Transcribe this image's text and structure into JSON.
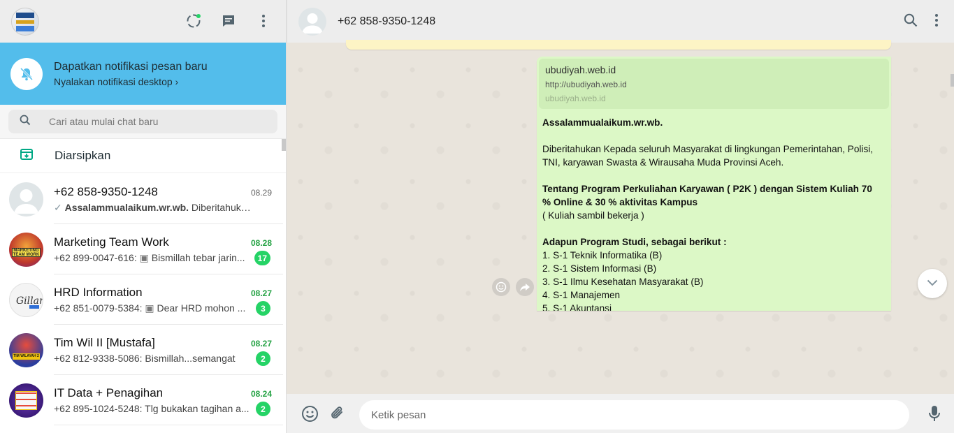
{
  "sidebar": {
    "notification": {
      "title": "Dapatkan notifikasi pesan baru",
      "link": "Nyalakan notifikasi desktop ›"
    },
    "search": {
      "placeholder": "Cari atau mulai chat baru"
    },
    "archived_label": "Diarsipkan",
    "chats": [
      {
        "name": "+62 858-9350-1248",
        "time": "08.29",
        "sender": "",
        "preview_bold": "Assalammualaikum.wr.wb.",
        "preview": " Diberitahukan K...",
        "unread": "",
        "avatar": "default"
      },
      {
        "name": "Marketing Team Work",
        "time": "08.28",
        "sender": "+62 899-0047-616: ",
        "preview_bold": "",
        "preview": "Bismillah tebar jarin...",
        "unread": "17",
        "avatar": "marketing"
      },
      {
        "name": "HRD Information",
        "time": "08.27",
        "sender": "+62 851-0079-5384: ",
        "preview_bold": "",
        "preview": "Dear HRD mohon ...",
        "unread": "3",
        "avatar": "hrd"
      },
      {
        "name": "Tim Wil II [Mustafa]",
        "time": "08.27",
        "sender": "+62 812-9338-5086: ",
        "preview_bold": "",
        "preview": "Bismillah...semangat",
        "unread": "2",
        "avatar": "timwil"
      },
      {
        "name": "IT Data + Penagihan",
        "time": "08.24",
        "sender": "+62 895-1024-5248: ",
        "preview_bold": "",
        "preview": "Tlg bukakan tagihan a...",
        "unread": "2",
        "avatar": "itdata"
      }
    ]
  },
  "conversation": {
    "contact_name": "+62 858-9350-1248",
    "link_preview": {
      "title": "ubudiyah.web.id",
      "url": "http://ubudiyah.web.id",
      "domain": "ubudiyah.web.id"
    },
    "message_lines": [
      {
        "text": "Assalammualaikum.wr.wb.",
        "bold": true
      },
      {
        "text": "",
        "bold": false
      },
      {
        "text": "Diberitahukan Kepada seluruh Masyarakat di lingkungan Pemerintahan, Polisi,",
        "bold": false
      },
      {
        "text": "TNI, karyawan Swasta & Wirausaha Muda Provinsi Aceh.",
        "bold": false
      },
      {
        "text": "",
        "bold": false
      },
      {
        "text": "Tentang Program Perkuliahan Karyawan ( P2K ) dengan  Sistem Kuliah 70",
        "bold": true
      },
      {
        "text": "%  Online & 30 % aktivitas Kampus",
        "bold": true
      },
      {
        "text": "( Kuliah sambil bekerja )",
        "bold": false
      },
      {
        "text": "",
        "bold": false
      },
      {
        "text": "Adapun Program Studi, sebagai berikut :",
        "bold": true
      },
      {
        "text": "1. S-1 Teknik Informatika (B)",
        "bold": false
      },
      {
        "text": "2. S-1 Sistem Informasi (B)",
        "bold": false
      },
      {
        "text": "3. S-1 Ilmu Kesehatan Masyarakat (B)",
        "bold": false
      },
      {
        "text": "4. S-1 Manajemen",
        "bold": false
      },
      {
        "text": "5. S-1 Akuntansi",
        "bold": false
      }
    ],
    "composer": {
      "placeholder": "Ketik pesan"
    }
  },
  "icons": {
    "status": "status-icon",
    "new_chat": "new-chat-icon",
    "menu": "menu-icon",
    "bell_off": "bell-off-icon",
    "search": "search-icon",
    "archive": "archive-icon",
    "emoji": "emoji-icon",
    "attach": "paperclip-icon",
    "mic": "mic-icon",
    "forward": "forward-icon",
    "chevron_down": "chevron-down-icon"
  },
  "colors": {
    "banner": "#53bdeb",
    "badge": "#25d366",
    "bubble_out": "#dcf8c6",
    "unread_time": "#25a244"
  }
}
